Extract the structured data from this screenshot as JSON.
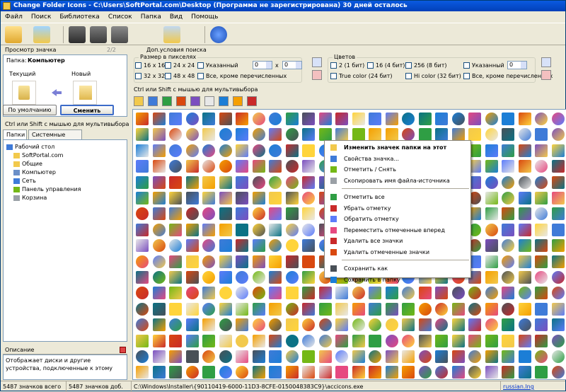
{
  "window": {
    "title": "Change Folder Icons - C:\\Users\\SoftPortal.com\\Desktop (Программа не зарегистрирована) 30 дней осталось"
  },
  "menu": [
    "Файл",
    "Поиск",
    "Библиотека",
    "Список",
    "Папка",
    "Вид",
    "Помощь"
  ],
  "toolbar": {
    "icons": [
      "open-folder-icon",
      "browse-icon",
      "save-icon",
      "save-disk-icon",
      "save-as-icon",
      "calendar-icon",
      "help-icon"
    ]
  },
  "preview": {
    "header": "Просмотр значка",
    "counter": "2/2",
    "folder_label": "Папка:",
    "folder_name": "Компьютер",
    "current_label": "Текущий",
    "new_label": "Новый",
    "default_button": "По умолчанию",
    "change_button": "Сменить"
  },
  "select_hint": "Ctrl или Shift с мышью для мультивыбора",
  "tabs": [
    "Папки",
    "Системные папки"
  ],
  "tree": [
    {
      "label": "Рабочий стол",
      "indent": 0,
      "icon": "desktop-icon"
    },
    {
      "label": "SoftPortal.com",
      "indent": 1,
      "icon": "user-folder-icon"
    },
    {
      "label": "Общие",
      "indent": 1,
      "icon": "shared-folder-icon"
    },
    {
      "label": "Компьютер",
      "indent": 1,
      "icon": "computer-icon"
    },
    {
      "label": "Сеть",
      "indent": 1,
      "icon": "network-icon"
    },
    {
      "label": "Панель управления",
      "indent": 1,
      "icon": "control-panel-icon"
    },
    {
      "label": "Корзина",
      "indent": 1,
      "icon": "recycle-bin-icon"
    }
  ],
  "description": {
    "header": "Описание",
    "text": "Отображает диски и другие устройства, подключенные к этому"
  },
  "options": {
    "extra_title": "Доп.условия поиска",
    "size_title": "Размер в пикселях",
    "sizes": [
      "16 x 16",
      "24 x 24",
      "Указанный",
      "32 x 32",
      "48 x 48",
      "Все, кроме перечисленных"
    ],
    "spin_w": "0",
    "spin_x": "x",
    "spin_h": "0",
    "colors_title": "Цветов",
    "colors": [
      "2 (1 бит)",
      "16 (4 бит)",
      "256 (8 бит)",
      "Указанный",
      "True color (24 бит)",
      "Hi color (32 бит)",
      "Все, кроме перечисленных"
    ],
    "color_spin": "0"
  },
  "icons_hint": "Ctrl или Shift с мышью для мультивыбора",
  "context_menu": [
    {
      "label": "Изменить значек папки на этот",
      "bold": true,
      "icon": "folder-change-icon"
    },
    {
      "label": "Свойства значка...",
      "icon": "properties-icon"
    },
    {
      "label": "Отметить / Снять",
      "icon": "toggle-mark-icon"
    },
    {
      "label": "Скопировать имя файла-источника",
      "icon": "copy-icon"
    },
    {
      "sep": true
    },
    {
      "label": "Отметить все",
      "icon": "mark-all-icon"
    },
    {
      "label": "Убрать отметку",
      "icon": "unmark-icon"
    },
    {
      "label": "Обратить отметку",
      "icon": "invert-mark-icon"
    },
    {
      "label": "Переместить отмеченные вперед",
      "icon": "move-forward-icon"
    },
    {
      "label": "Удалить все значки",
      "icon": "delete-all-icon"
    },
    {
      "label": "Удалить отмеченные значки",
      "icon": "delete-marked-icon"
    },
    {
      "sep": true
    },
    {
      "label": "Сохранить как",
      "icon": "save-as-icon"
    },
    {
      "label": "Сохранить в папку",
      "icon": "save-to-folder-icon"
    }
  ],
  "status": {
    "total": "5487 значков всего",
    "added": "5487 значков доб.",
    "path": "C:\\Windows\\Installer\\{90110419-6000-11D3-8CFE-0150048383C9}\\accicons.exe",
    "lang": "russian.lng"
  },
  "palette": [
    "#f2c94c",
    "#3f7bd8",
    "#2f9e44",
    "#d9480f",
    "#7b4fbf",
    "#e8e8e8",
    "#1c7ed6",
    "#f59f00",
    "#c92a2a",
    "#0b7285",
    "#495057",
    "#ffd43b",
    "#74b816",
    "#5c7cfa",
    "#e64980"
  ]
}
